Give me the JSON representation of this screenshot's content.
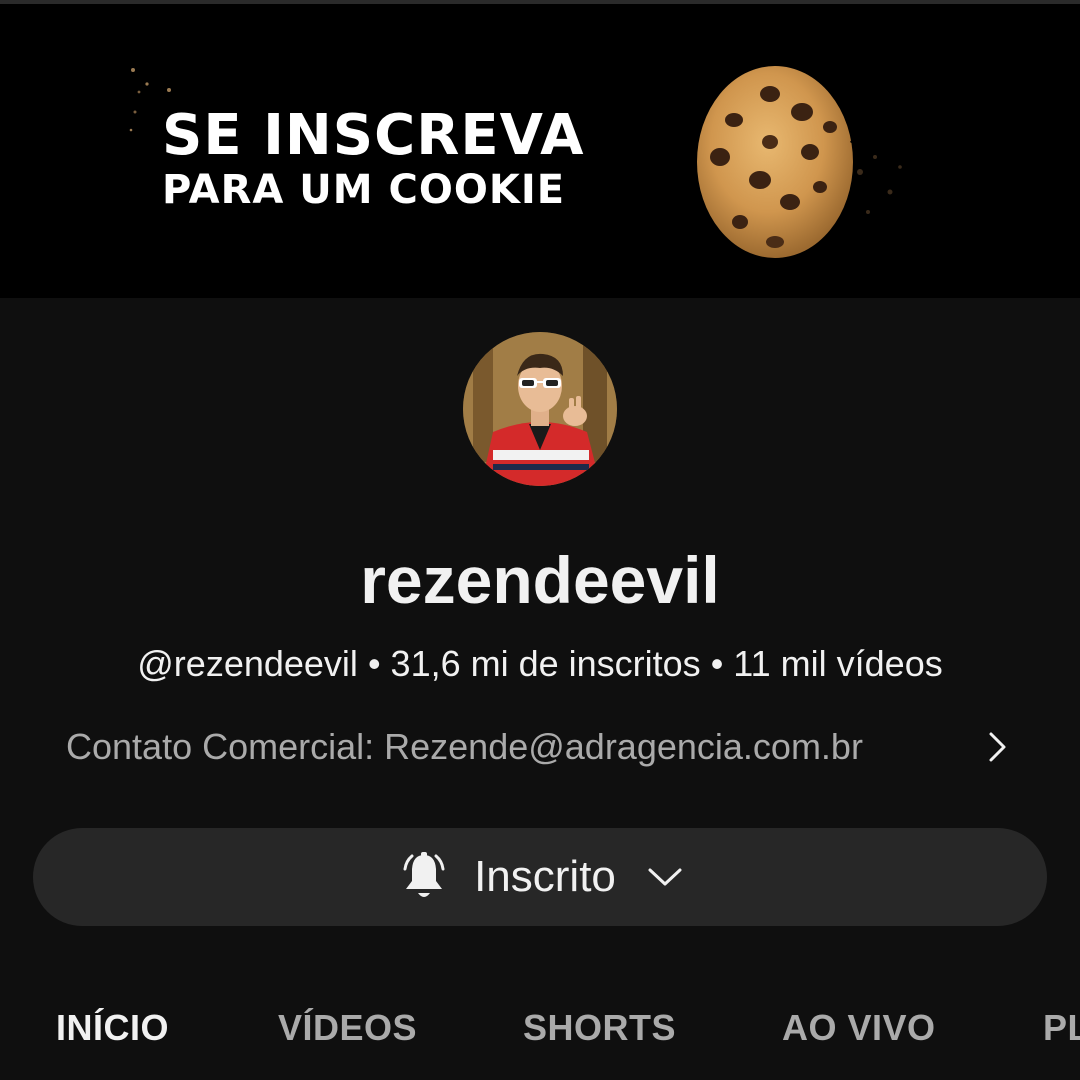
{
  "banner": {
    "line1": "SE INSCREVA",
    "line2": "PARA UM COOKIE",
    "image_icon": "cookie-icon"
  },
  "channel": {
    "avatar_icon": "avatar",
    "name": "rezendeevil",
    "handle": "@rezendeevil",
    "separator": "•",
    "subscribers": "31,6 mi de inscritos",
    "videos": "11 mil vídeos",
    "contact": "Contato Comercial: Rezende@adragencia.com.br"
  },
  "subscribe": {
    "label": "Inscrito",
    "bell_icon": "bell-icon",
    "dropdown_icon": "chevron-down-icon"
  },
  "tabs": [
    {
      "label": "INÍCIO",
      "active": true
    },
    {
      "label": "VÍDEOS",
      "active": false
    },
    {
      "label": "SHORTS",
      "active": false
    },
    {
      "label": "AO VIVO",
      "active": false
    },
    {
      "label": "PL",
      "active": false
    }
  ],
  "colors": {
    "background": "#0f0f0f",
    "button": "#272727",
    "text_primary": "#f1f1f1",
    "text_secondary": "#aaaaaa"
  }
}
